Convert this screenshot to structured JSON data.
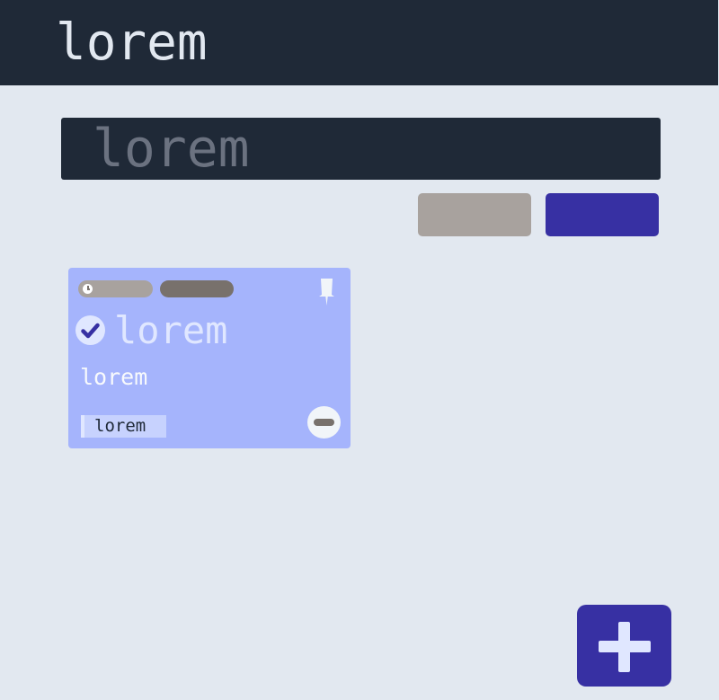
{
  "header": {
    "title": "lorem"
  },
  "search": {
    "text": "lorem"
  },
  "actions": {
    "secondary_label": "",
    "primary_label": ""
  },
  "card": {
    "title": "lorem",
    "body": "lorem",
    "label": "lorem",
    "tags": [
      {
        "icon": "clock-icon",
        "text": ""
      },
      {
        "text": ""
      }
    ],
    "pinned": true,
    "completed": true
  },
  "icons": {
    "pin": "pin-icon",
    "check": "check-circle-icon",
    "remove": "minus-circle-icon",
    "add": "plus-icon"
  },
  "colors": {
    "header_bg": "#1f2937",
    "page_bg": "#e2e8f0",
    "primary": "#3730a3",
    "secondary": "#a8a29e",
    "card_bg": "#a5b4fc"
  }
}
